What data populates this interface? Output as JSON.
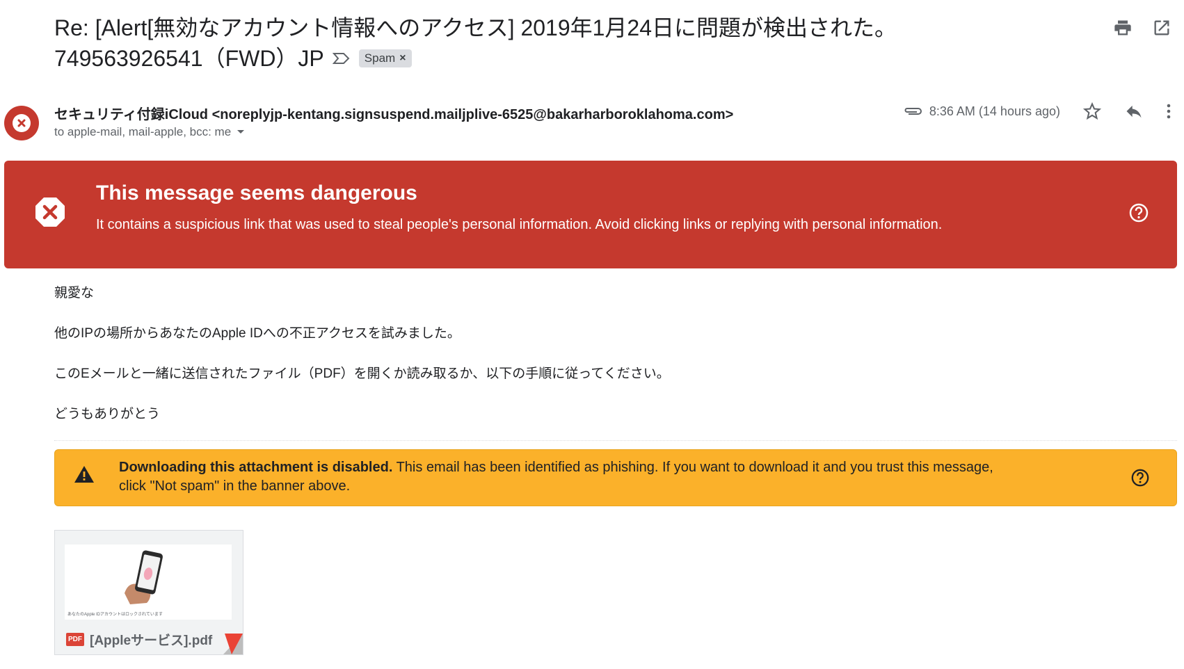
{
  "email": {
    "subject_line1": "Re: [Alert[無効なアカウント情報へのアクセス] 2019年1月24日に問題が検出された。",
    "subject_line2": "749563926541（FWD）JP",
    "spam_label": "Spam",
    "spam_remove": "×",
    "sender": "セキュリティ付録iCloud <noreplyjp-kentang.signsuspend.mailjplive-6525@bakarharboroklahoma.com>",
    "recipients": "to apple-mail, mail-apple, bcc: me",
    "time": "8:36 AM (14 hours ago)",
    "body": [
      "親愛な",
      "他のIPの場所からあなたのApple IDへの不正アクセスを試みました。",
      "このEメールと一緒に送信されたファイル（PDF）を開くか読み取るか、以下の手順に従ってください。",
      "どうもありがとう"
    ]
  },
  "danger_banner": {
    "title": "This message seems dangerous",
    "description": "It contains a suspicious link that was used to steal people's personal information. Avoid clicking links or replying with personal information."
  },
  "warning_banner": {
    "bold": "Downloading this attachment is disabled.",
    "text": " This email has been identified as phishing. If you want to download it and you trust this message, click \"Not spam\" in the banner above."
  },
  "attachment": {
    "badge": "PDF",
    "filename": "[Appleサービス].pdf",
    "preview_caption": "あなたのApple IDアカウントはロックされています"
  },
  "colors": {
    "danger": "#c5392e",
    "warning": "#fbb12a"
  }
}
